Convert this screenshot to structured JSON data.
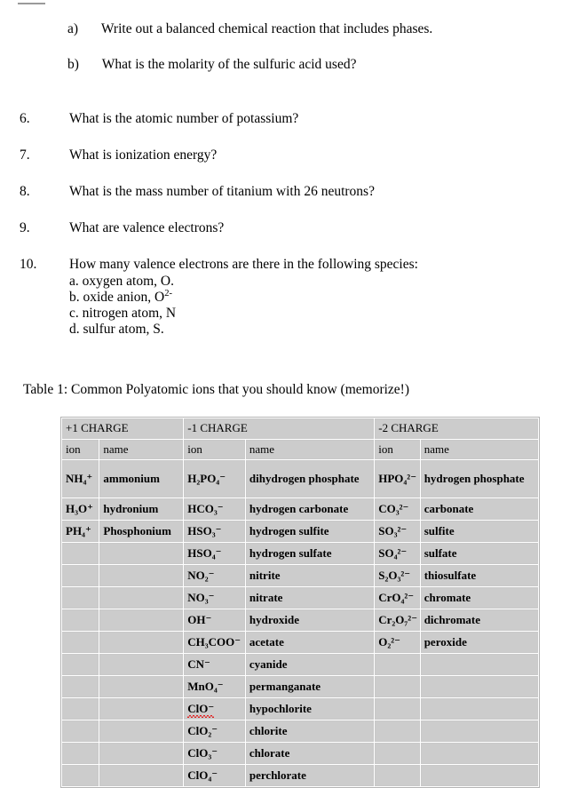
{
  "questions": {
    "sub_items": [
      {
        "label": "a)",
        "text": "Write out a balanced chemical reaction that includes phases."
      },
      {
        "label": "b)",
        "text": "What is the molarity of the sulfuric acid used?"
      }
    ],
    "numbered": [
      {
        "number": "6.",
        "text": "What is the atomic number of potassium?"
      },
      {
        "number": "7.",
        "text": "What is ionization energy?"
      },
      {
        "number": "8.",
        "text": "What is the mass number of titanium with 26 neutrons?"
      },
      {
        "number": "9.",
        "text": "What are valence electrons?"
      },
      {
        "number": "10.",
        "text": "How many valence electrons are there in the following species:"
      }
    ],
    "q10_subparts": [
      {
        "label": "a.",
        "text": "oxygen atom, O."
      },
      {
        "label": "b.",
        "text": "oxide anion, O",
        "sup": "2-"
      },
      {
        "label": "c.",
        "text": "nitrogen atom, N"
      },
      {
        "label": "d.",
        "text": "sulfur atom, S."
      }
    ]
  },
  "table": {
    "caption": "Table 1: Common Polyatomic ions that you should know (memorize!)",
    "charge_headers": [
      "+1 CHARGE",
      "-1 CHARGE",
      "-2 CHARGE"
    ],
    "sub_headers": [
      "ion",
      "name",
      "ion",
      "name",
      "ion",
      "name"
    ],
    "rows": [
      {
        "plus1_ion": "NH₄⁺",
        "plus1_name": "ammonium",
        "minus1_ion": "H₂PO₄⁻",
        "minus1_name": "dihydrogen phosphate",
        "minus2_ion": "HPO₄²⁻",
        "minus2_name": "hydrogen phosphate",
        "tall": true
      },
      {
        "plus1_ion": "H₃O⁺",
        "plus1_name": "hydronium",
        "minus1_ion": "HCO₃⁻",
        "minus1_name": "hydrogen carbonate",
        "minus2_ion": "CO₃²⁻",
        "minus2_name": "carbonate"
      },
      {
        "plus1_ion": "PH₄⁺",
        "plus1_name": "Phosphonium",
        "minus1_ion": "HSO₃⁻",
        "minus1_name": "hydrogen sulfite",
        "minus2_ion": "SO₃²⁻",
        "minus2_name": "sulfite"
      },
      {
        "plus1_ion": "",
        "plus1_name": "",
        "minus1_ion": "HSO₄⁻",
        "minus1_name": "hydrogen sulfate",
        "minus2_ion": "SO₄²⁻",
        "minus2_name": "sulfate"
      },
      {
        "plus1_ion": "",
        "plus1_name": "",
        "minus1_ion": "NO₂⁻",
        "minus1_name": "nitrite",
        "minus2_ion": "S₂O₃²⁻",
        "minus2_name": "thiosulfate"
      },
      {
        "plus1_ion": "",
        "plus1_name": "",
        "minus1_ion": "NO₃⁻",
        "minus1_name": "nitrate",
        "minus2_ion": "CrO₄²⁻",
        "minus2_name": "chromate"
      },
      {
        "plus1_ion": "",
        "plus1_name": "",
        "minus1_ion": "OH⁻",
        "minus1_name": "hydroxide",
        "minus2_ion": "Cr₂O₇²⁻",
        "minus2_name": "dichromate"
      },
      {
        "plus1_ion": "",
        "plus1_name": "",
        "minus1_ion": "CH₃COO⁻",
        "minus1_name": "acetate",
        "minus2_ion": "O₂²⁻",
        "minus2_name": "peroxide"
      },
      {
        "plus1_ion": "",
        "plus1_name": "",
        "minus1_ion": "CN⁻",
        "minus1_name": "cyanide",
        "minus2_ion": "",
        "minus2_name": ""
      },
      {
        "plus1_ion": "",
        "plus1_name": "",
        "minus1_ion": "MnO₄⁻",
        "minus1_name": "permanganate",
        "minus2_ion": "",
        "minus2_name": ""
      },
      {
        "plus1_ion": "",
        "plus1_name": "",
        "minus1_ion": "ClO⁻",
        "minus1_name": "hypochlorite",
        "minus2_ion": "",
        "minus2_name": "",
        "misspelled": true
      },
      {
        "plus1_ion": "",
        "plus1_name": "",
        "minus1_ion": "ClO₂⁻",
        "minus1_name": "chlorite",
        "minus2_ion": "",
        "minus2_name": ""
      },
      {
        "plus1_ion": "",
        "plus1_name": "",
        "minus1_ion": "ClO₃⁻",
        "minus1_name": "chlorate",
        "minus2_ion": "",
        "minus2_name": ""
      },
      {
        "plus1_ion": "",
        "plus1_name": "",
        "minus1_ion": "ClO₄⁻",
        "minus1_name": "perchlorate",
        "minus2_ion": "",
        "minus2_name": ""
      }
    ]
  },
  "colors": {
    "cell_gray": "#cccccc",
    "cell_white": "#ffffff",
    "border": "#c9c9c9",
    "spellcheck_red": "#e02020"
  }
}
